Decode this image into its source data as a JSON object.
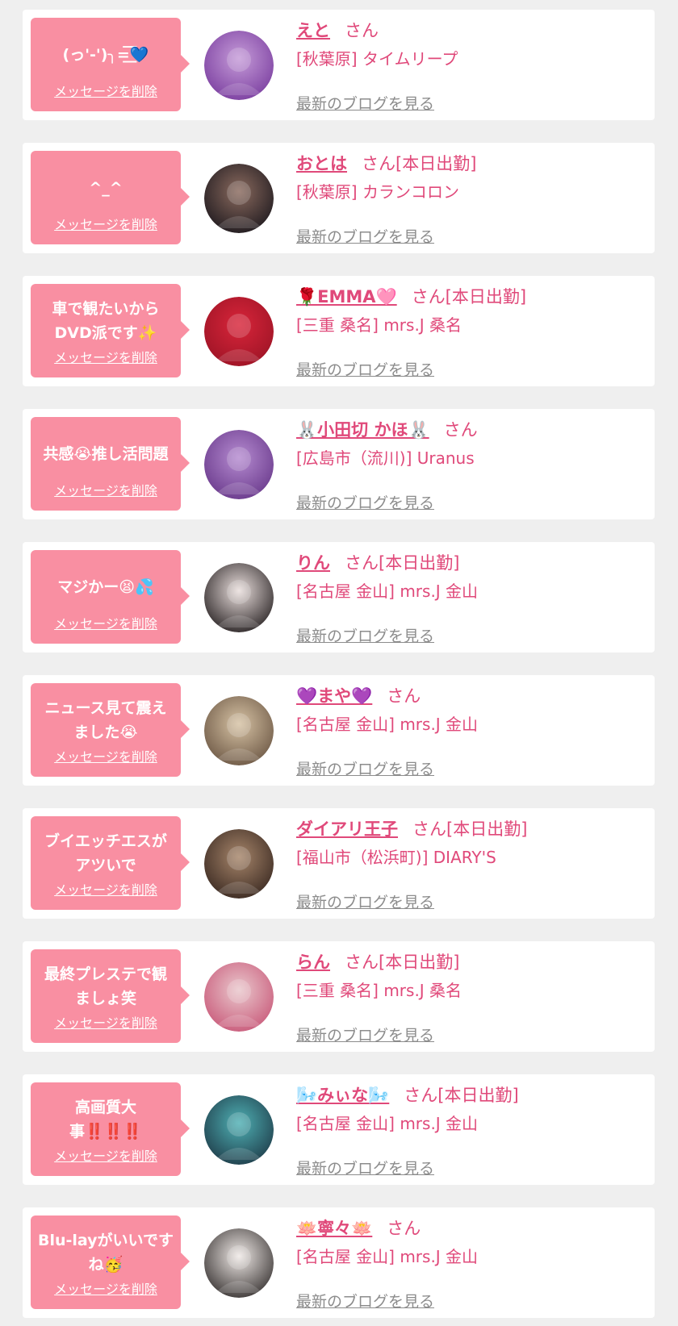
{
  "delete_label": "メッセージを削除",
  "blog_label": "最新のブログを見る",
  "san_label": "さん",
  "entries": [
    {
      "message": "(っ'-')╮=͟͟͞͞💙",
      "name": "えと",
      "status": "",
      "shop": "[秋葉原] タイムリープ",
      "avatar_colors": [
        "#c59bd8",
        "#7b3fa0"
      ]
    },
    {
      "message": "^_^",
      "name": "おとは",
      "status": "[本日出勤]",
      "shop": "[秋葉原] カランコロン",
      "avatar_colors": [
        "#8a6a5e",
        "#1f1a1f"
      ]
    },
    {
      "message": "車で観たいから DVD派です✨",
      "name": "🌹EMMA🩷",
      "status": "[本日出勤]",
      "shop": "[三重 桑名] mrs.J 桑名",
      "avatar_colors": [
        "#d8253a",
        "#9e1426"
      ]
    },
    {
      "message": "共感😭推し活問題",
      "name": "🐰小田切 かほ🐰",
      "status": "",
      "shop": "[広島市（流川)] Uranus",
      "avatar_colors": [
        "#b58bd0",
        "#6a3a8c"
      ]
    },
    {
      "message": "マジかー😫💦",
      "name": "りん",
      "status": "[本日出勤]",
      "shop": "[名古屋 金山] mrs.J 金山",
      "avatar_colors": [
        "#e9dedc",
        "#2b2526"
      ]
    },
    {
      "message": "ニュース見て震え ました😭",
      "name": "💜まや💜",
      "status": "",
      "shop": "[名古屋 金山] mrs.J 金山",
      "avatar_colors": [
        "#d6c2a4",
        "#6d5845"
      ]
    },
    {
      "message": "ブイエッチエスが アツいで",
      "name": "ダイアリ王子",
      "status": "[本日出勤]",
      "shop": "[福山市（松浜町)] DIARY'S",
      "avatar_colors": [
        "#a6856a",
        "#3b2a22"
      ]
    },
    {
      "message": "最終プレステで観 ましょ笑",
      "name": "らん",
      "status": "[本日出勤]",
      "shop": "[三重 桑名] mrs.J 桑名",
      "avatar_colors": [
        "#e9c7cc",
        "#c95a7a"
      ]
    },
    {
      "message": "高画質大 事‼️‼️‼️",
      "name": "🌬️みぃな🌬️",
      "status": "[本日出勤]",
      "shop": "[名古屋 金山] mrs.J 金山",
      "avatar_colors": [
        "#4fb0b4",
        "#1f3d4a"
      ]
    },
    {
      "message": "Blu-layがいいです ね🥳",
      "name": "🪷寧々🪷",
      "status": "",
      "shop": "[名古屋 金山] mrs.J 金山",
      "avatar_colors": [
        "#efe9e6",
        "#3a3534"
      ]
    }
  ]
}
